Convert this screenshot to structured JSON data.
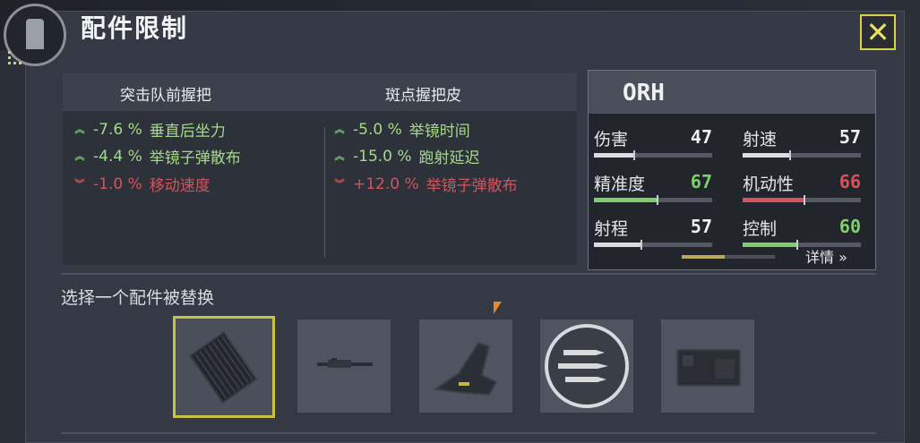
{
  "header": {
    "title": "配件限制",
    "close_label": "✕"
  },
  "effects": {
    "columns": [
      {
        "name": "突击队前握把",
        "items": [
          {
            "value": "-7.6 %",
            "label": "垂直后坐力",
            "type": "good"
          },
          {
            "value": "-4.4 %",
            "label": "举镜子弹散布",
            "type": "good"
          },
          {
            "value": "-1.0 %",
            "label": "移动速度",
            "type": "bad"
          }
        ]
      },
      {
        "name": "斑点握把皮",
        "items": [
          {
            "value": "-5.0 %",
            "label": "举镜时间",
            "type": "good"
          },
          {
            "value": "-15.0 %",
            "label": "跑射延迟",
            "type": "good"
          },
          {
            "value": "+12.0 %",
            "label": "举镜子弹散布",
            "type": "bad"
          }
        ]
      }
    ]
  },
  "weapon": {
    "name": "ORH",
    "stats": [
      {
        "label": "伤害",
        "value": "47",
        "fill": 0.34,
        "color": "#eef0f3"
      },
      {
        "label": "射速",
        "value": "57",
        "fill": 0.4,
        "color": "#eef0f3"
      },
      {
        "label": "精准度",
        "value": "67",
        "fill": 0.54,
        "color": "#7ed06a"
      },
      {
        "label": "机动性",
        "value": "66",
        "fill": 0.52,
        "color": "#d6545c"
      },
      {
        "label": "射程",
        "value": "57",
        "fill": 0.4,
        "color": "#eef0f3"
      },
      {
        "label": "控制",
        "value": "60",
        "fill": 0.46,
        "color": "#7ed06a"
      }
    ],
    "details_label": "详情 »"
  },
  "select": {
    "label": "选择一个配件被替换",
    "attachments": [
      {
        "icon": "grip-tape-icon",
        "selected": true
      },
      {
        "icon": "rifle-barrel-icon",
        "selected": false
      },
      {
        "icon": "stock-icon",
        "selected": false
      },
      {
        "icon": "ammo-icon",
        "selected": false
      },
      {
        "icon": "magazine-icon",
        "selected": false
      }
    ]
  },
  "colors": {
    "accent": "#d9d44a",
    "good": "#76c56b",
    "bad": "#d2545c"
  }
}
